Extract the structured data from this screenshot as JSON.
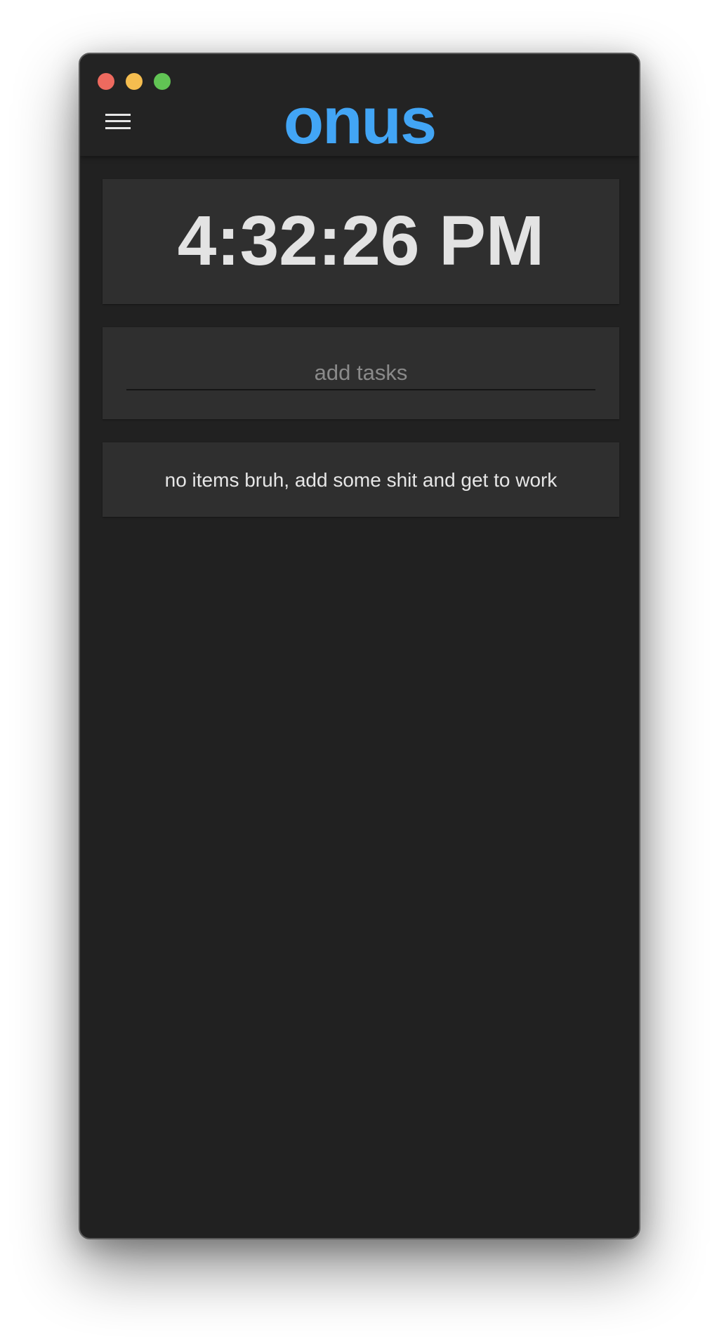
{
  "window": {
    "controls": {
      "close": {
        "icon": "close-dot",
        "color": "#ee6a5f"
      },
      "minimize": {
        "icon": "minimize-dot",
        "color": "#f5bd4f"
      },
      "maximize": {
        "icon": "maximize-dot",
        "color": "#61c454"
      }
    }
  },
  "header": {
    "menu_icon": "hamburger-menu-icon",
    "brand": "onus",
    "brand_color": "#42a5f5"
  },
  "clock": {
    "time": "4:32:26 PM"
  },
  "task_input": {
    "placeholder": "add tasks",
    "value": ""
  },
  "tasks": {
    "items": [],
    "empty_message": "no items bruh, add some shit and get to work"
  }
}
